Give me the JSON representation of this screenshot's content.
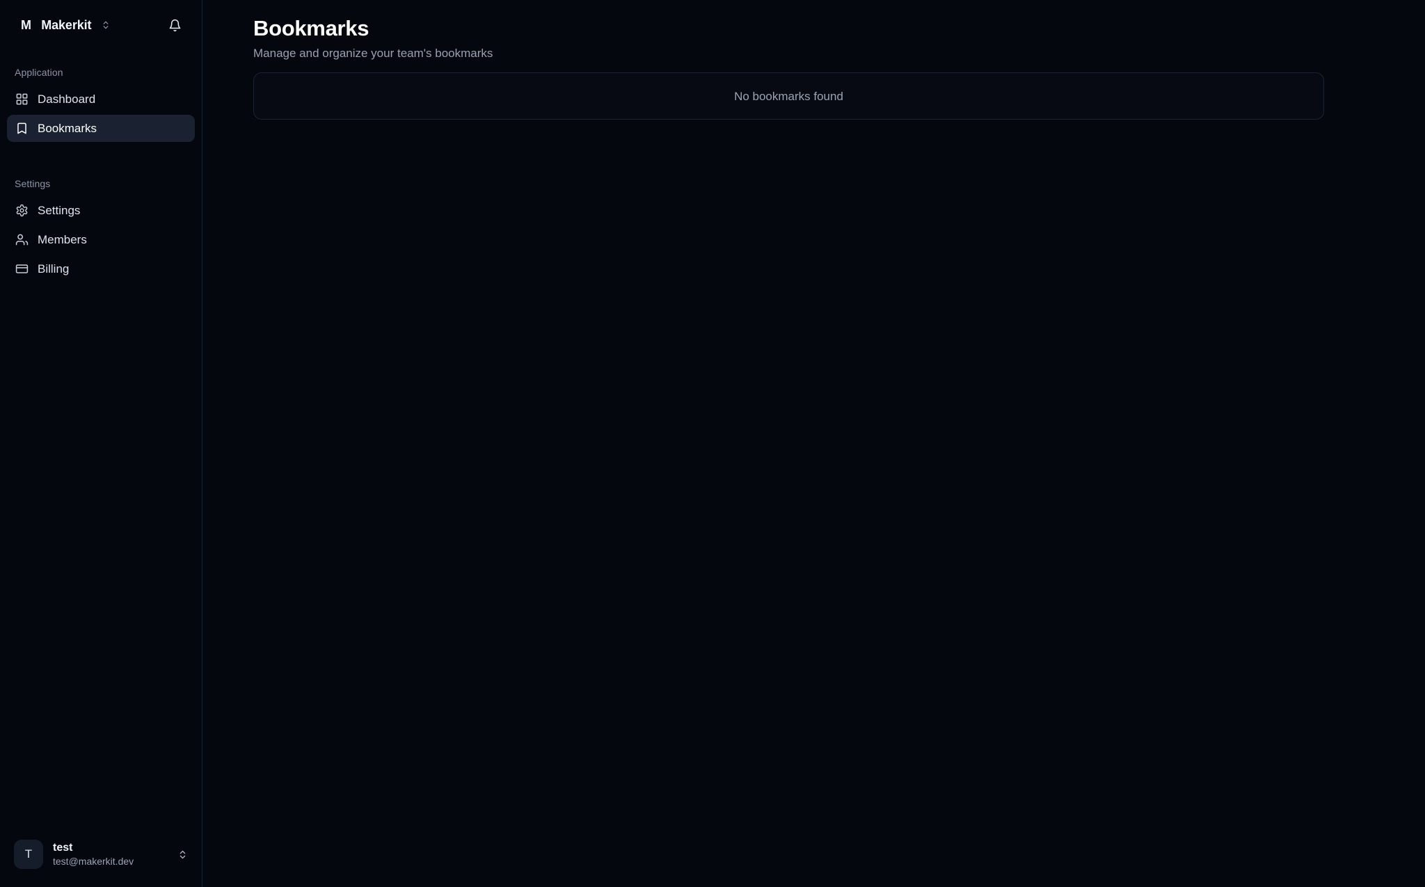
{
  "sidebar": {
    "brand": {
      "mark": "M",
      "name": "Makerkit",
      "switcher_icon": "chevrons-up-down-icon"
    },
    "notifications": {
      "icon": "bell-icon",
      "label": "Notifications"
    },
    "groups": [
      {
        "label": "Application",
        "items": [
          {
            "label": "Dashboard",
            "icon": "layout-grid-icon",
            "active": false
          },
          {
            "label": "Bookmarks",
            "icon": "bookmark-icon",
            "active": true
          }
        ]
      },
      {
        "label": "Settings",
        "items": [
          {
            "label": "Settings",
            "icon": "gear-icon",
            "active": false
          },
          {
            "label": "Members",
            "icon": "users-icon",
            "active": false
          },
          {
            "label": "Billing",
            "icon": "credit-card-icon",
            "active": false
          }
        ]
      }
    ],
    "profile": {
      "avatar_initial": "T",
      "name": "test",
      "email": "test@makerkit.dev",
      "switcher_icon": "chevrons-up-down-icon"
    }
  },
  "main": {
    "title": "Bookmarks",
    "subtitle": "Manage and organize your team's bookmarks",
    "empty_state": {
      "message": "No bookmarks found"
    }
  },
  "colors": {
    "background": "#05070e",
    "sidebar_background": "#05070e",
    "sidebar_border": "#192232",
    "active_item_background": "#1a2130",
    "card_border": "#1b2433",
    "text_primary": "#ffffff",
    "text_muted": "#97a1b2"
  }
}
